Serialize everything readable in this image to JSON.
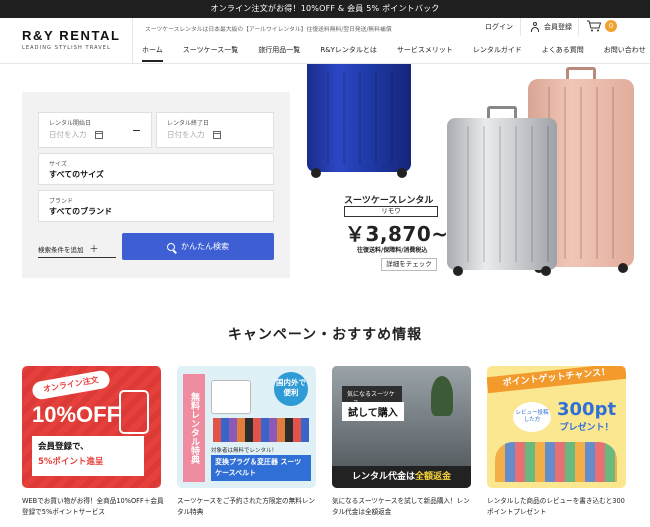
{
  "announcement": "オンライン注文がお得！10%OFF & 会員 5% ポイントバック",
  "header": {
    "logo_main": "R&Y RENTAL",
    "logo_sub": "LEADING STYLISH TRAVEL",
    "tagline": "スーツケースレンタルは日本最大級の【アールワイレンタル】往復送料無料/翌日発送/無料補償",
    "login": "ログイン",
    "register": "会員登録",
    "cart_count": "0",
    "nav": [
      "ホーム",
      "スーツケース一覧",
      "旅行用品一覧",
      "R&Yレンタルとは",
      "サービスメリット",
      "レンタルガイド",
      "よくある質問",
      "お問い合わせ"
    ]
  },
  "search": {
    "start_label": "レンタル開始日",
    "start_placeholder": "日付を入力",
    "end_label": "レンタル終了日",
    "end_placeholder": "日付を入力",
    "size_label": "サイズ",
    "size_value": "すべてのサイズ",
    "brand_label": "ブランド",
    "brand_value": "すべてのブランド",
    "add_condition": "検索条件を追加",
    "add_icon": "＋",
    "submit": "かんたん検索"
  },
  "hero": {
    "title": "スーツケースレンタル",
    "brand": "リモワ",
    "price": "￥3,870~",
    "note": "往復送料/保障料/消費税込",
    "detail_button": "詳細をチェック"
  },
  "campaign": {
    "title": "キャンペーン・おすすめ情報",
    "cards": [
      {
        "pill": "オンライン注文",
        "big": "10%OFF",
        "line1": "会員登録で、",
        "line2": "5%ポイント進呈",
        "desc": "WEBでお買い物がお得！全商品10%OFF＋会員登録で5%ポイントサービス"
      },
      {
        "banner": "無料レンタル特典",
        "badge": "国内外で便利",
        "note": "対象者は無料でレンタル！",
        "tag": "変換プラグ＆変圧器 スーツケースベルト",
        "desc": "スーツケースをご予約された方限定の無料レンタル特典"
      },
      {
        "head": "気になるスーツケース",
        "big": "試して購入",
        "bottom_a": "レンタル代金は",
        "bottom_b": "全額返金",
        "desc": "気になるスーツケースを試して新品購入！レンタル代金は全額返金"
      },
      {
        "ribbon": "ポイントゲットチャンス！",
        "bubble": "レビュー投稿した方",
        "points": "300pt",
        "gift": "プレゼント！",
        "desc": "レンタルした商品のレビューを書き込むと300ポイントプレゼント"
      }
    ]
  }
}
